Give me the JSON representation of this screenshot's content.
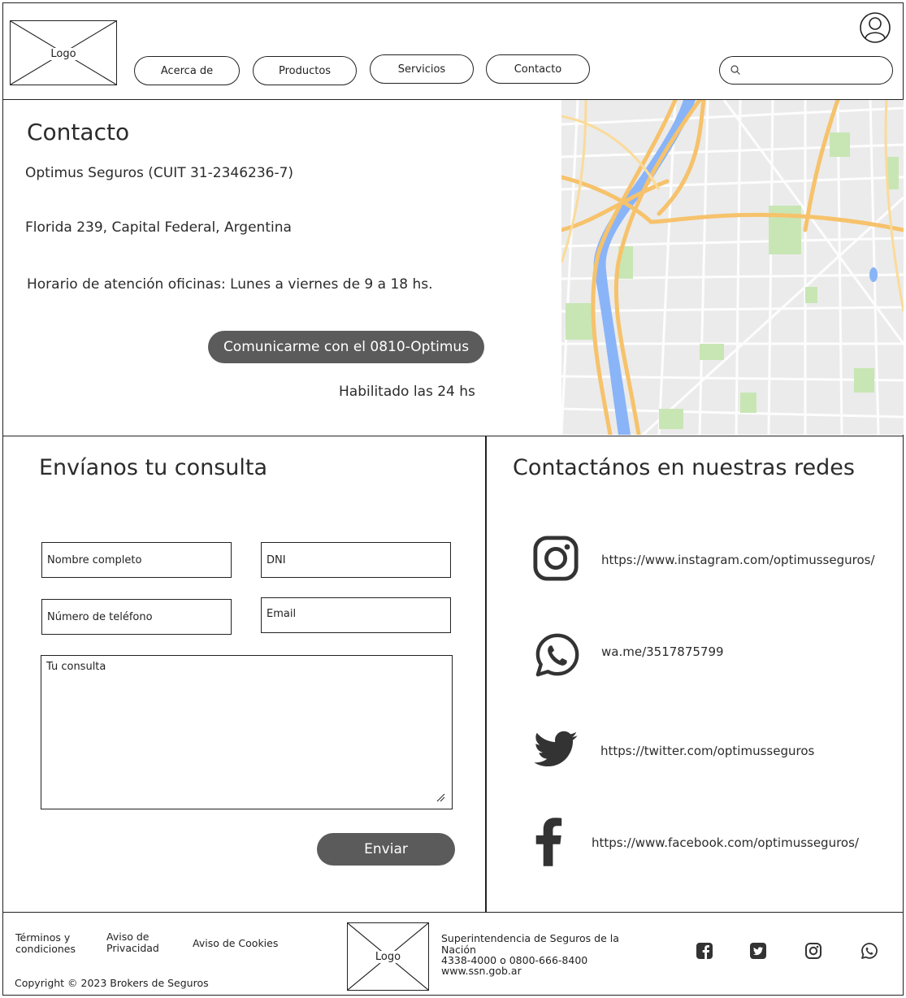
{
  "header": {
    "logo_label": "Logo",
    "nav": [
      {
        "label": "Acerca de"
      },
      {
        "label": "Productos"
      },
      {
        "label": "Servicios"
      },
      {
        "label": "Contacto"
      }
    ],
    "search_placeholder": ""
  },
  "contact": {
    "title": "Contacto",
    "company": "Optimus Seguros (CUIT 31-2346236-7)",
    "address": "Florida 239, Capital Federal, Argentina",
    "hours": "Horario de atención oficinas: Lunes a viernes de 9 a 18 hs.",
    "call_button": "Comunicarme con el 0810-Optimus",
    "call_note": "Habilitado las 24 hs"
  },
  "form": {
    "title": "Envíanos tu consulta",
    "name_placeholder": "Nombre completo",
    "dni_placeholder": "DNI",
    "phone_placeholder": "Número de teléfono",
    "email_placeholder": "Email",
    "message_placeholder": "Tu consulta",
    "submit_label": "Enviar"
  },
  "social": {
    "title": "Contactános en nuestras redes",
    "items": [
      {
        "icon": "instagram-icon",
        "link": "https://www.instagram.com/optimusseguros/"
      },
      {
        "icon": "whatsapp-icon",
        "link": "wa.me/3517875799"
      },
      {
        "icon": "twitter-icon",
        "link": "https://twitter.com/optimusseguros"
      },
      {
        "icon": "facebook-icon",
        "link": "https://www.facebook.com/optimusseguros/"
      }
    ]
  },
  "footer": {
    "terms": "Términos y\ncondiciones",
    "privacy": "Aviso de\nPrivacidad",
    "cookies": "Aviso de Cookies",
    "copyright": "Copyright © 2023 Brokers de Seguros",
    "logo_label": "Logo",
    "ssn_line1": "Superintendencia de Seguros de la",
    "ssn_line2": "Nación",
    "ssn_phone": "4338-4000 o 0800-666-8400",
    "ssn_url": "www.ssn.gob.ar",
    "icons": [
      "facebook-icon",
      "twitter-icon",
      "instagram-icon",
      "whatsapp-icon"
    ]
  },
  "colors": {
    "dark_button": "#5b5b5b",
    "map_road": "#f6c26b",
    "map_river": "#8ab4f8",
    "map_park": "#c6e5b0"
  }
}
